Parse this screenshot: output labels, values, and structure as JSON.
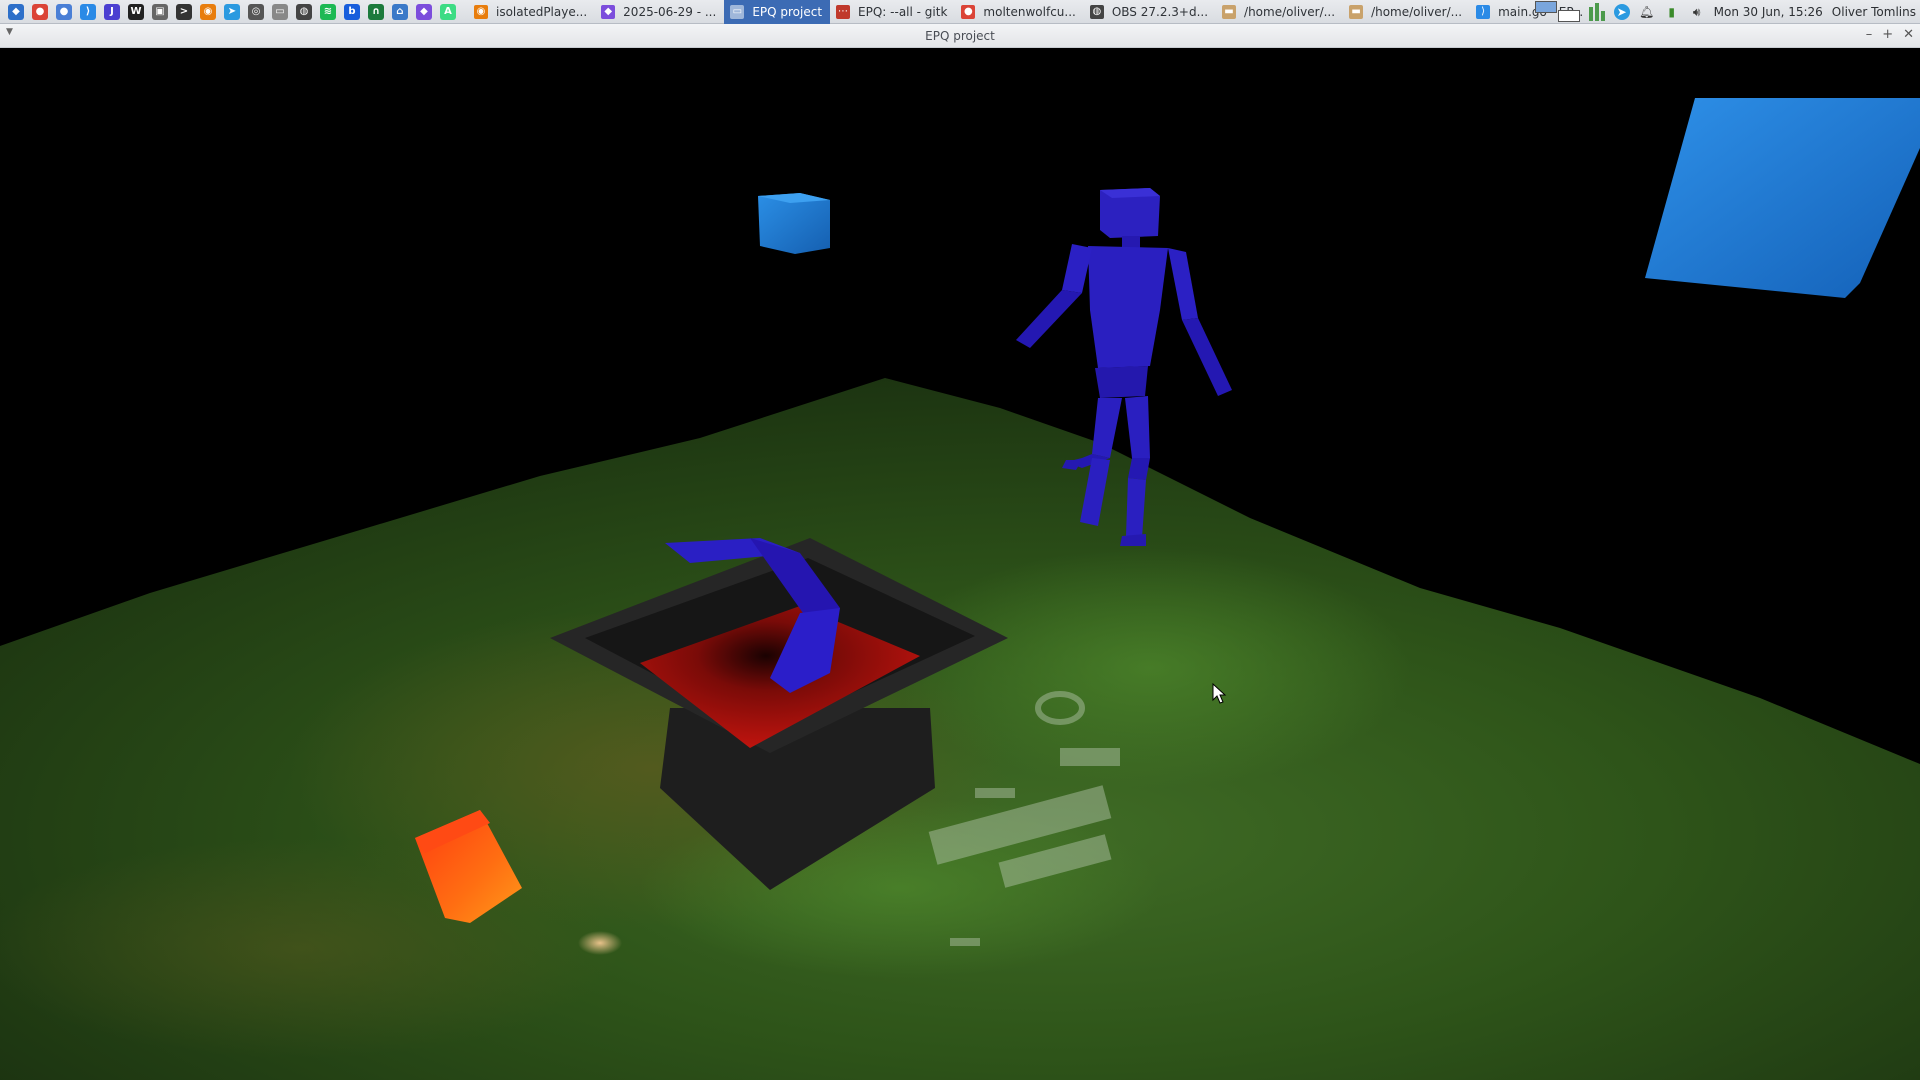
{
  "panel": {
    "launchers": [
      {
        "icon": "xfce-menu-icon",
        "color": "#2d6fc9",
        "glyph": "◆"
      },
      {
        "icon": "chrome-icon",
        "color": "#db4437",
        "glyph": "●"
      },
      {
        "icon": "chromium-icon",
        "color": "#4a7fd6",
        "glyph": "●"
      },
      {
        "icon": "vscode-icon",
        "color": "#2a8ae6",
        "glyph": "⟩"
      },
      {
        "icon": "jetbrains-icon",
        "color": "#4b3fd1",
        "glyph": "J"
      },
      {
        "icon": "writer-icon",
        "color": "#222222",
        "glyph": "W"
      },
      {
        "icon": "screenshot-icon",
        "color": "#666666",
        "glyph": "▣"
      },
      {
        "icon": "terminal-icon",
        "color": "#333333",
        "glyph": ">"
      },
      {
        "icon": "blender-icon",
        "color": "#e87d0d",
        "glyph": "◉"
      },
      {
        "icon": "telegram-icon",
        "color": "#2b9ae0",
        "glyph": "➤"
      },
      {
        "icon": "spy-icon",
        "color": "#555555",
        "glyph": "◎"
      },
      {
        "icon": "files-icon",
        "color": "#888888",
        "glyph": "▭"
      },
      {
        "icon": "obs-icon",
        "color": "#444444",
        "glyph": "◍"
      },
      {
        "icon": "spotify-icon",
        "color": "#1db954",
        "glyph": "≋"
      },
      {
        "icon": "bitwarden-icon",
        "color": "#175ddc",
        "glyph": "b"
      },
      {
        "icon": "headphones-icon",
        "color": "#1c7a3c",
        "glyph": "∩"
      },
      {
        "icon": "network-icon",
        "color": "#3a79c8",
        "glyph": "⌂"
      },
      {
        "icon": "obsidian-icon",
        "color": "#7c4ddc",
        "glyph": "◆"
      },
      {
        "icon": "android-studio-icon",
        "color": "#3ddc84",
        "glyph": "A"
      }
    ],
    "tasks": [
      {
        "label": "isolatedPlaye...",
        "icon": "blender-icon",
        "color": "#e87d0d",
        "glyph": "◉",
        "active": false
      },
      {
        "label": "2025-06-29 - ...",
        "icon": "obsidian-icon",
        "color": "#7c4ddc",
        "glyph": "◆",
        "active": false
      },
      {
        "label": "EPQ project",
        "icon": "window-icon",
        "color": "#9fb7da",
        "glyph": "▭",
        "active": true
      },
      {
        "label": "EPQ: --all - gitk",
        "icon": "gitk-icon",
        "color": "#c0392b",
        "glyph": "⋯",
        "active": false
      },
      {
        "label": "moltenwolfcu...",
        "icon": "chrome-icon",
        "color": "#db4437",
        "glyph": "●",
        "active": false
      },
      {
        "label": "OBS 27.2.3+d...",
        "icon": "obs-icon",
        "color": "#444444",
        "glyph": "◍",
        "active": false
      },
      {
        "label": "/home/oliver/...",
        "icon": "folder-icon",
        "color": "#c9a26b",
        "glyph": "▬",
        "active": false
      },
      {
        "label": "/home/oliver/...",
        "icon": "folder-icon",
        "color": "#c9a26b",
        "glyph": "▬",
        "active": false
      },
      {
        "label": "main.go - EP...",
        "icon": "vscode-icon",
        "color": "#2a8ae6",
        "glyph": "⟩",
        "active": false
      }
    ],
    "tray": {
      "clock": "Mon 30 Jun, 15:26",
      "user": "Oliver Tomlins"
    }
  },
  "window": {
    "title": "EPQ project",
    "minimize": "–",
    "maximize": "+",
    "close": "✕"
  },
  "scene": {
    "sky_color": "#000000",
    "terrain_color": "#2c4f1a",
    "character_color": "#2b1fb8",
    "cube_blue": "#1f7fd6",
    "cube_orange": "#ff6a10",
    "pit_red": "#c0140e"
  }
}
